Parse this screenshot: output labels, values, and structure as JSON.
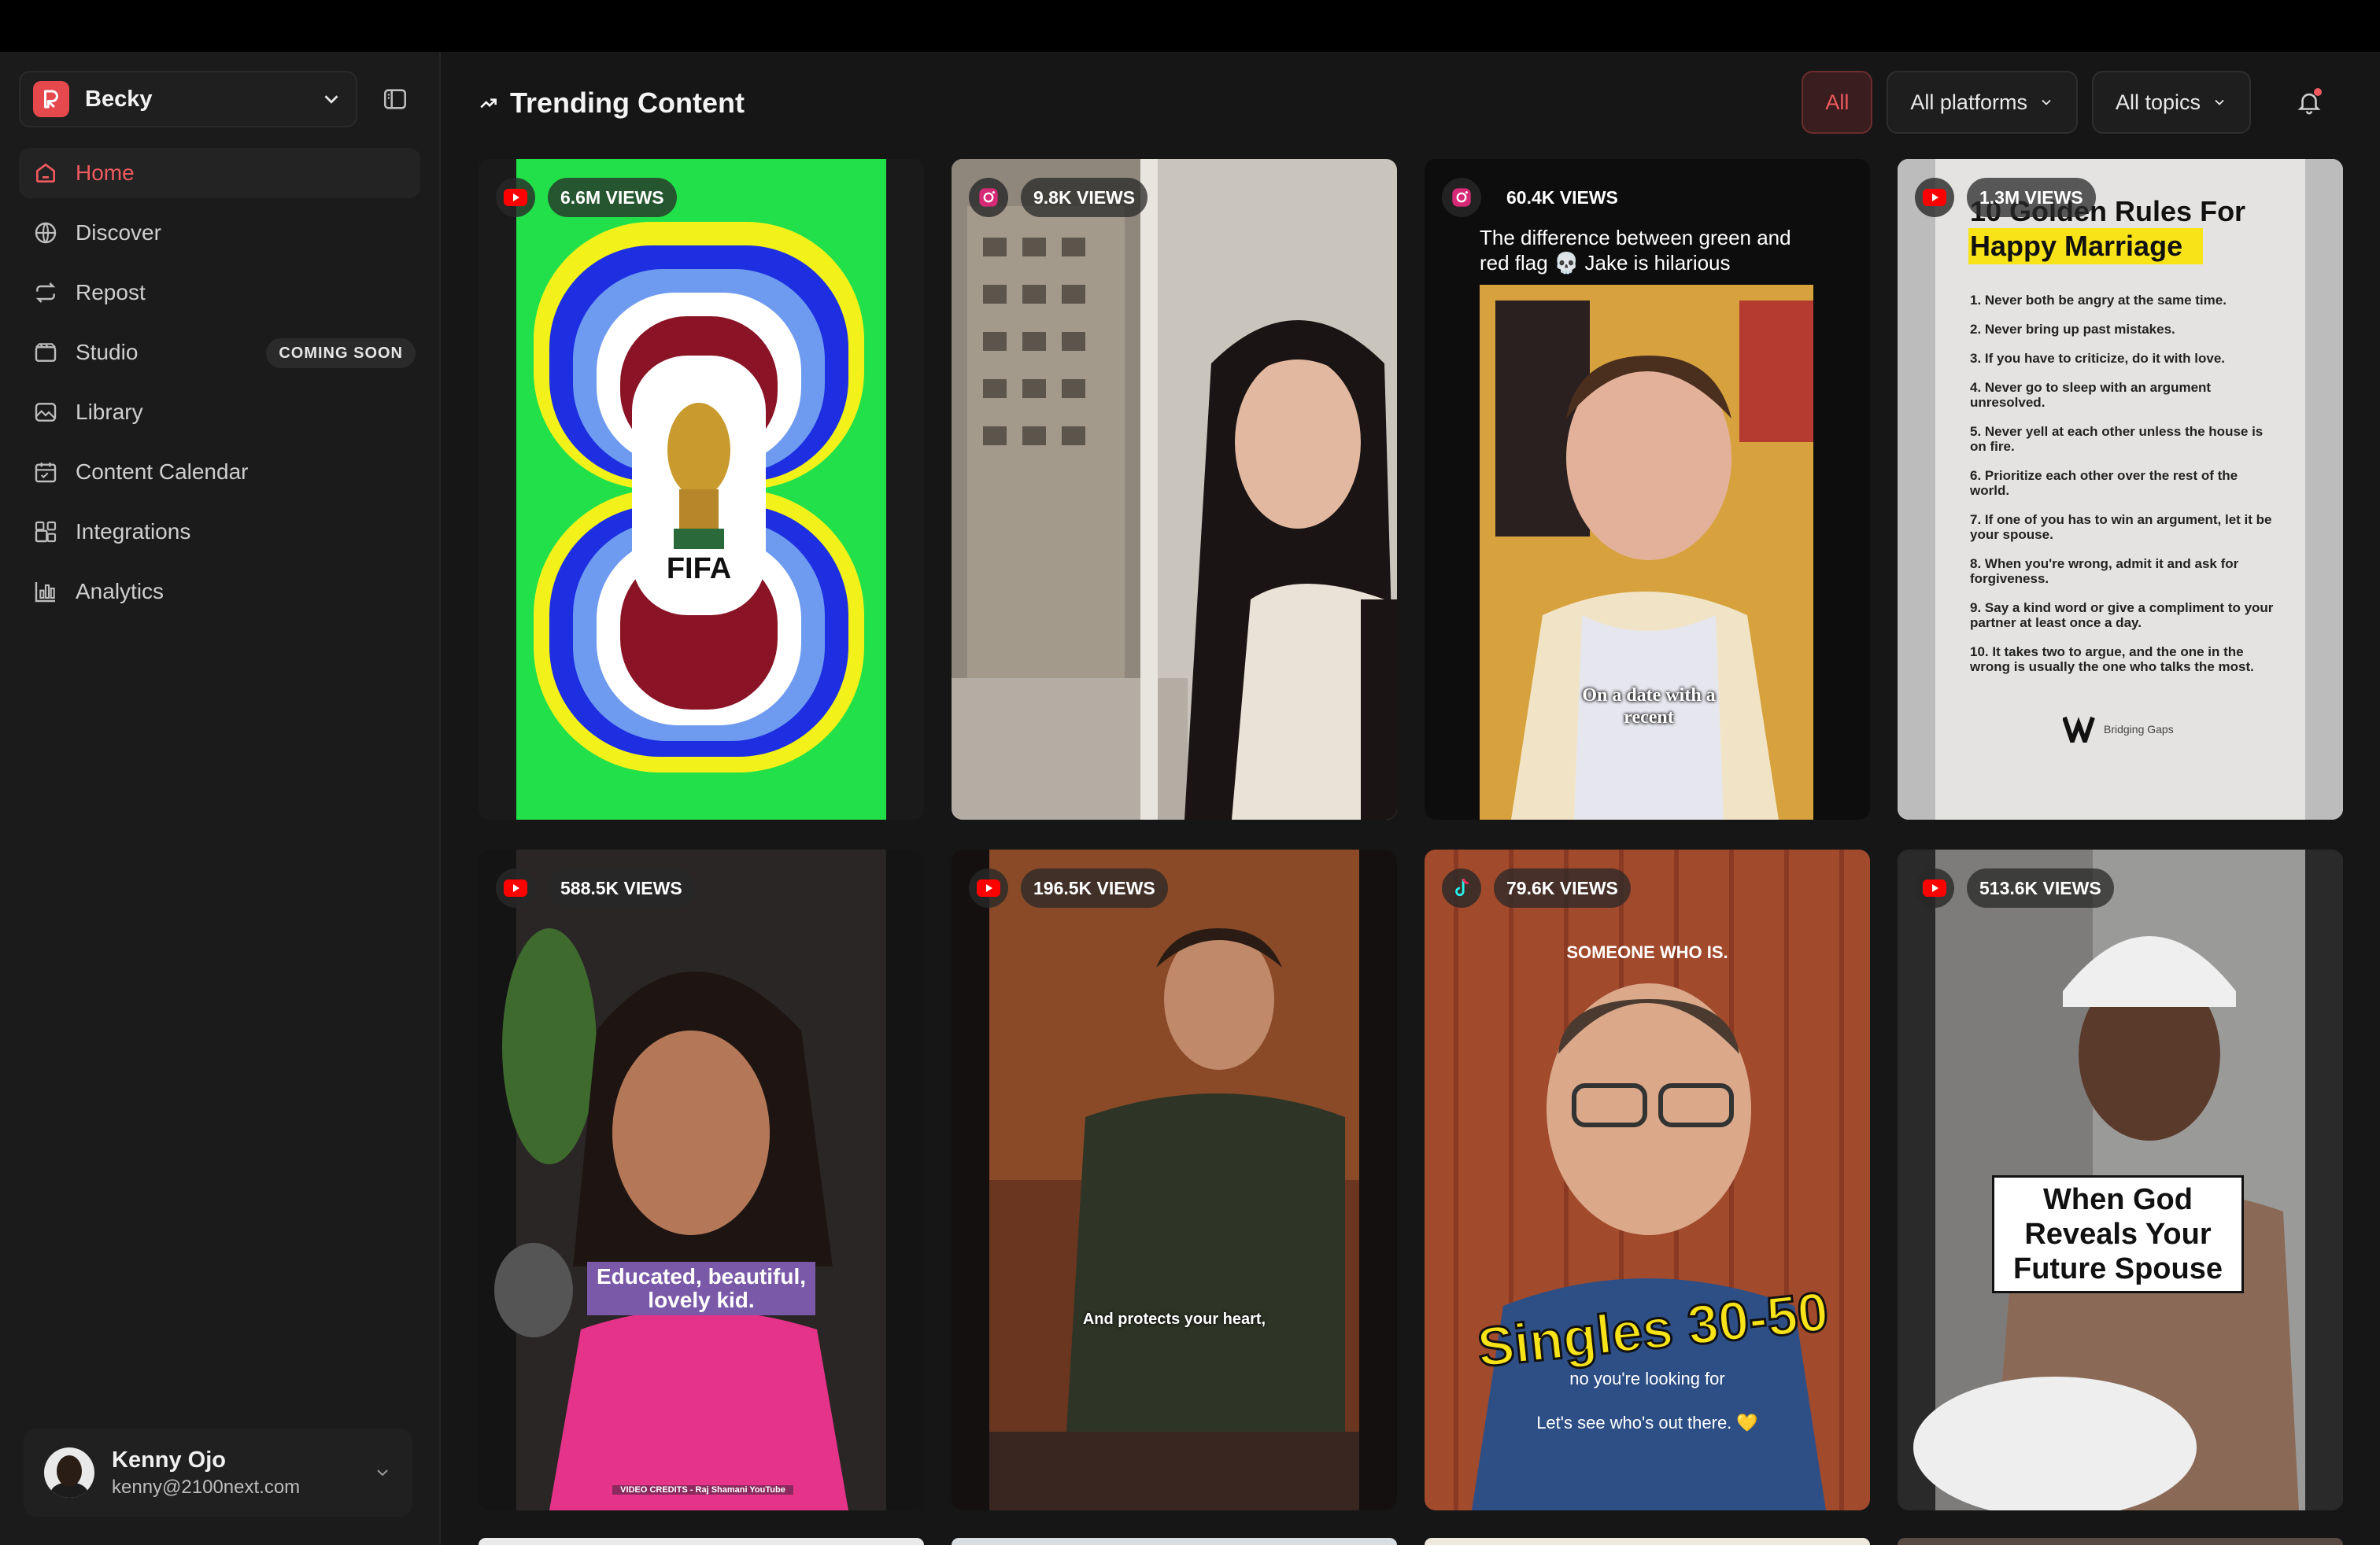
{
  "workspace": {
    "name": "Becky"
  },
  "nav": [
    {
      "label": "Home",
      "icon": "home-icon",
      "active": true
    },
    {
      "label": "Discover",
      "icon": "globe-icon"
    },
    {
      "label": "Repost",
      "icon": "repost-icon"
    },
    {
      "label": "Studio",
      "icon": "studio-icon",
      "badge": "COMING SOON"
    },
    {
      "label": "Library",
      "icon": "image-icon"
    },
    {
      "label": "Content Calendar",
      "icon": "calendar-icon"
    },
    {
      "label": "Integrations",
      "icon": "integrations-icon"
    },
    {
      "label": "Analytics",
      "icon": "analytics-icon"
    }
  ],
  "user": {
    "name": "Kenny Ojo",
    "email": "kenny@2100next.com"
  },
  "header": {
    "title": "Trending Content"
  },
  "filters": {
    "all": "All",
    "platforms": "All platforms",
    "topics": "All topics"
  },
  "colors": {
    "accent": "#f05a5f",
    "youtube": "#ff0000",
    "instagram": "#d62976",
    "tiktok": "#25f4ee"
  },
  "cards": [
    {
      "platform": "youtube",
      "views": "6.6M VIEWS",
      "caption": "FIFA"
    },
    {
      "platform": "instagram",
      "views": "9.8K VIEWS",
      "caption": ""
    },
    {
      "platform": "instagram",
      "views": "60.4K VIEWS",
      "caption": "The difference between green and red flag 💀 Jake is hilarious",
      "subcaption": "On a date with a recent"
    },
    {
      "platform": "youtube",
      "views": "1.3M VIEWS",
      "caption": "10 Golden Rules For",
      "highlight": "Happy Marriage",
      "rules": [
        "1. Never both be angry at the same time.",
        "2. Never bring up past mistakes.",
        "3. If you have to criticize, do it with love.",
        "4. Never go to sleep with an argument unresolved.",
        "5. Never yell at each other unless the house is on fire.",
        "6. Prioritize each other over the rest of the world.",
        "7. If one of you has to win an argument, let it be your spouse.",
        "8. When you're wrong, admit it and ask for forgiveness.",
        "9. Say a kind word or give a compliment to your partner at least once a day.",
        "10. It takes two to argue, and the one in the wrong is usually the one who talks the most."
      ],
      "brand": "Bridging Gaps"
    },
    {
      "platform": "youtube",
      "views": "588.5K VIEWS",
      "caption": "Educated, beautiful, lovely kid.",
      "credit": "VIDEO CREDITS - Raj Shamani YouTube"
    },
    {
      "platform": "youtube",
      "views": "196.5K VIEWS",
      "caption": "And protects your heart,"
    },
    {
      "platform": "tiktok",
      "views": "79.6K VIEWS",
      "top": "SOMEONE WHO IS.",
      "caption": "Singles 30-50",
      "sub1": "no you're looking for",
      "sub2": "Let's see who's out there. 💛"
    },
    {
      "platform": "youtube",
      "views": "513.6K VIEWS",
      "caption": "When God Reveals Your Future Spouse"
    }
  ]
}
